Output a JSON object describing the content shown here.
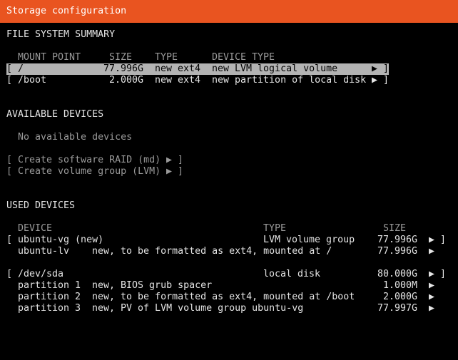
{
  "header": {
    "title": "Storage configuration"
  },
  "fs_summary": {
    "heading": "FILE SYSTEM SUMMARY",
    "columns": {
      "mount_point": "MOUNT POINT",
      "size": "SIZE",
      "type": "TYPE",
      "device_type": "DEVICE TYPE"
    },
    "rows": [
      {
        "open": "[",
        "mount": "/",
        "size": "77.996G",
        "type": "new ext4",
        "device_type": "new LVM logical volume",
        "arrow": "▶",
        "close": "]"
      },
      {
        "open": "[",
        "mount": "/boot",
        "size": "2.000G",
        "type": "new ext4",
        "device_type": "new partition of local disk",
        "arrow": "▶",
        "close": "]"
      }
    ]
  },
  "available": {
    "heading": "AVAILABLE DEVICES",
    "empty_text": "No available devices",
    "actions": [
      {
        "open": "[",
        "label": "Create software RAID (md)",
        "arrow": "▶",
        "close": "]"
      },
      {
        "open": "[",
        "label": "Create volume group (LVM)",
        "arrow": "▶",
        "close": "]"
      }
    ]
  },
  "used": {
    "heading": "USED DEVICES",
    "columns": {
      "device": "DEVICE",
      "type": "TYPE",
      "size": "SIZE"
    },
    "rows": [
      {
        "open": "[",
        "device": "ubuntu-vg (new)",
        "type": "LVM volume group",
        "size": "77.996G",
        "arrow": "▶",
        "close": "]"
      },
      {
        "open": "",
        "device": "ubuntu-lv",
        "desc": "new, to be formatted as ext4, mounted at /",
        "size": "77.996G",
        "arrow": "▶",
        "close": ""
      },
      {
        "open": "[",
        "device": "/dev/sda",
        "type": "local disk",
        "size": "80.000G",
        "arrow": "▶",
        "close": "]"
      },
      {
        "open": "",
        "device": "partition 1",
        "desc": "new, BIOS grub spacer",
        "size": "1.000M",
        "arrow": "▶",
        "close": ""
      },
      {
        "open": "",
        "device": "partition 2",
        "desc": "new, to be formatted as ext4, mounted at /boot",
        "size": "2.000G",
        "arrow": "▶",
        "close": ""
      },
      {
        "open": "",
        "device": "partition 3",
        "desc": "new, PV of LVM volume group ubuntu-vg",
        "size": "77.997G",
        "arrow": "▶",
        "close": ""
      }
    ]
  },
  "colors": {
    "header_bg": "#e95420",
    "selected_bg": "#b3b3b3",
    "text": "#e4e4e4",
    "dim": "#9a9a9a"
  }
}
